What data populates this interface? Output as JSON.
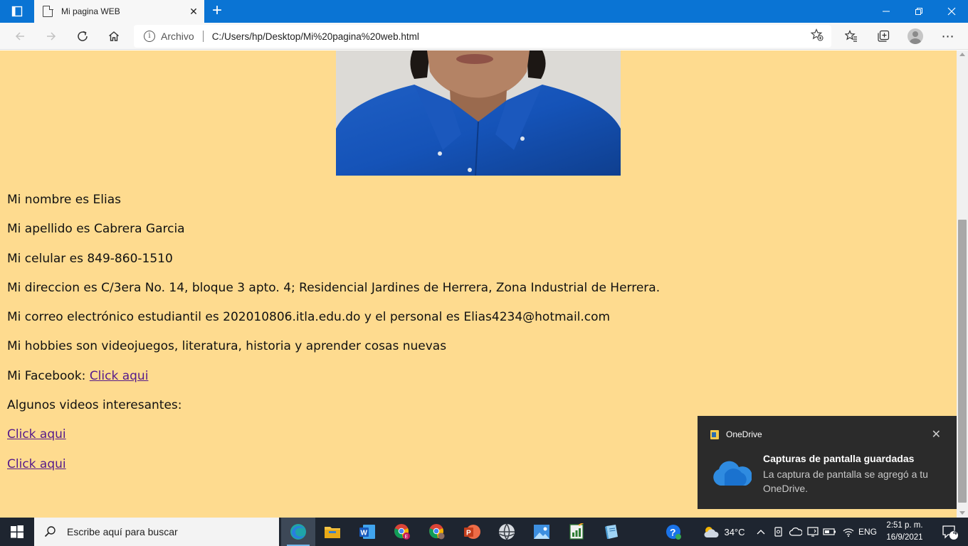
{
  "browser": {
    "tab_title": "Mi pagina WEB",
    "address_scheme": "Archivo",
    "address_url": "C:/Users/hp/Desktop/Mi%20pagina%20web.html"
  },
  "page": {
    "background_color": "#fedb8f",
    "link_color": "#551a8b",
    "lines": {
      "name": "Mi nombre es Elias",
      "surname": "Mi apellido es Cabrera Garcia",
      "phone": "Mi celular es 849-860-1510",
      "address": "Mi direccion es C/3era No. 14, bloque 3 apto. 4; Residencial Jardines de Herrera, Zona Industrial de Herrera.",
      "email": "Mi correo electrónico estudiantil es 202010806.itla.edu.do y el personal es Elias4234@hotmail.com",
      "hobbies": "Mi hobbies son videojuegos, literatura, historia y aprender cosas nuevas",
      "facebook_prefix": "Mi Facebook: ",
      "facebook_link": "Click aqui",
      "videos_heading": "Algunos videos interesantes:",
      "video_link_1": "Click aqui",
      "video_link_2": "Click aqui"
    }
  },
  "notification": {
    "app": "OneDrive",
    "title": "Capturas de pantalla guardadas",
    "body": "La captura de pantalla se agregó a tu OneDrive."
  },
  "taskbar": {
    "search_placeholder": "Escribe aquí para buscar",
    "temperature": "34°C",
    "language": "ENG",
    "time": "2:51 p. m.",
    "date": "16/9/2021",
    "notification_count": "4"
  }
}
